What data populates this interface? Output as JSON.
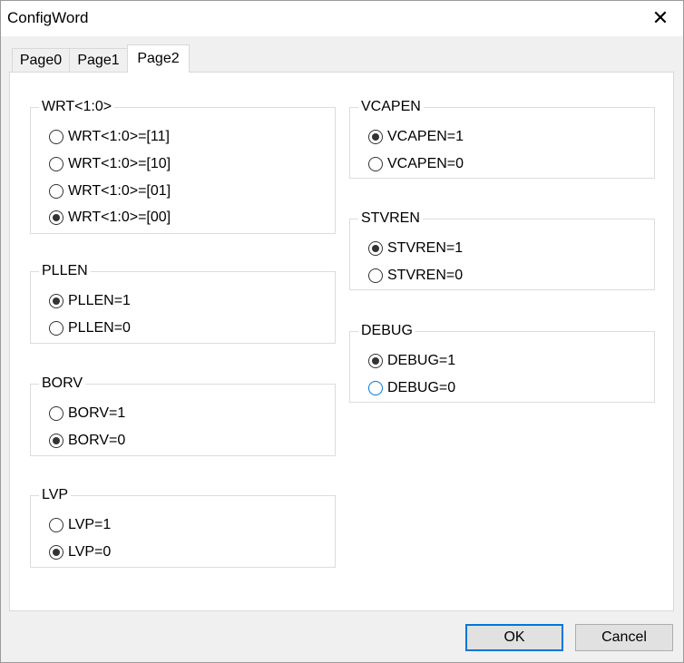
{
  "window": {
    "title": "ConfigWord",
    "close_glyph": "✕"
  },
  "tabs": [
    {
      "label": "Page0"
    },
    {
      "label": "Page1"
    },
    {
      "label": "Page2",
      "selected": true
    }
  ],
  "groups": {
    "wrt": {
      "title": "WRT<1:0>",
      "options": [
        "WRT<1:0>=[11]",
        "WRT<1:0>=[10]",
        "WRT<1:0>=[01]",
        "WRT<1:0>=[00]"
      ],
      "selected": 3
    },
    "pllen": {
      "title": "PLLEN",
      "options": [
        "PLLEN=1",
        "PLLEN=0"
      ],
      "selected": 0
    },
    "borv": {
      "title": "BORV",
      "options": [
        "BORV=1",
        "BORV=0"
      ],
      "selected": 1
    },
    "lvp": {
      "title": "LVP",
      "options": [
        "LVP=1",
        "LVP=0"
      ],
      "selected": 1
    },
    "vcapen": {
      "title": "VCAPEN",
      "options": [
        "VCAPEN=1",
        "VCAPEN=0"
      ],
      "selected": 0
    },
    "stvren": {
      "title": "STVREN",
      "options": [
        "STVREN=1",
        "STVREN=0"
      ],
      "selected": 0
    },
    "debug": {
      "title": "DEBUG",
      "options": [
        "DEBUG=1",
        "DEBUG=0"
      ],
      "selected": 0,
      "focused": 1
    }
  },
  "buttons": {
    "ok": "OK",
    "cancel": "Cancel"
  },
  "colors": {
    "focus_accent": "#0078d7"
  }
}
